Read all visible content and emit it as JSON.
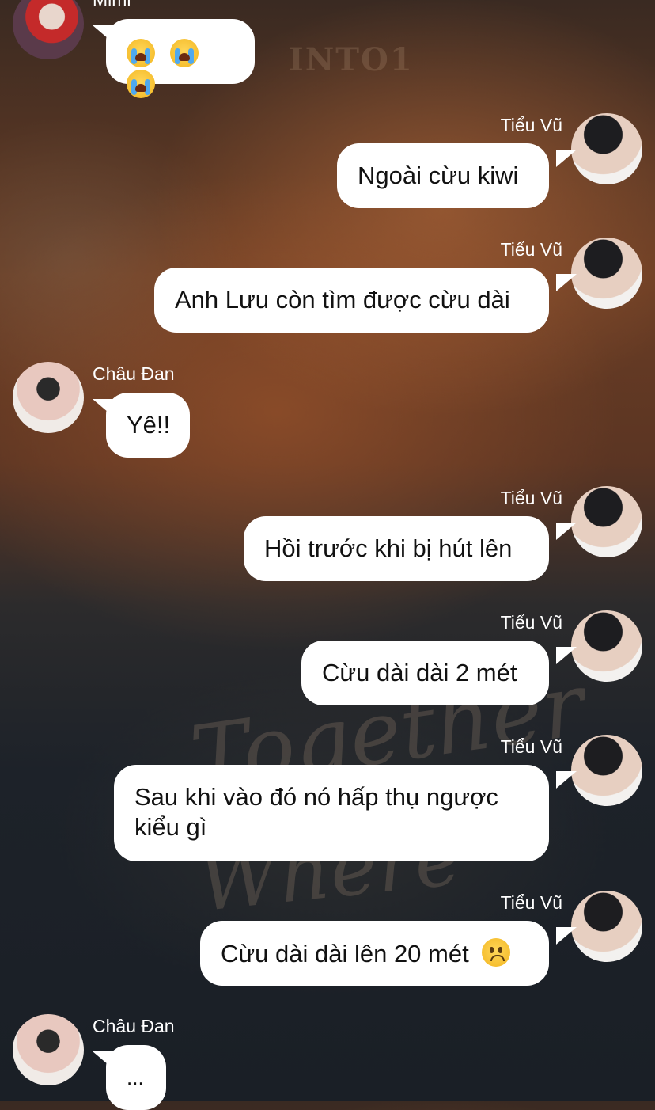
{
  "messages": [
    {
      "sender": "Mimi",
      "side": "left",
      "text": "😭😭😭"
    },
    {
      "sender": "Tiểu Vũ",
      "side": "right",
      "text": "Ngoài cừu kiwi"
    },
    {
      "sender": "Tiểu Vũ",
      "side": "right",
      "text": "Anh Lưu còn tìm được cừu dài"
    },
    {
      "sender": "Châu Đan",
      "side": "left",
      "text": "Yê!!"
    },
    {
      "sender": "Tiểu Vũ",
      "side": "right",
      "text": "Hồi trước khi bị hút lên"
    },
    {
      "sender": "Tiểu Vũ",
      "side": "right",
      "text": "Cừu dài dài 2 mét"
    },
    {
      "sender": "Tiểu Vũ",
      "side": "right",
      "text": "Sau khi vào đó nó hấp thụ ngược",
      "text2": "kiểu gì"
    },
    {
      "sender": "Tiểu Vũ",
      "side": "right",
      "text": "Cừu dài dài lên 20 mét",
      "emoji": "worried-face"
    },
    {
      "sender": "Châu Đan",
      "side": "left",
      "text": "..."
    }
  ],
  "watermark": {
    "top": "INTO1",
    "mid": "Together",
    "low": "Where"
  }
}
